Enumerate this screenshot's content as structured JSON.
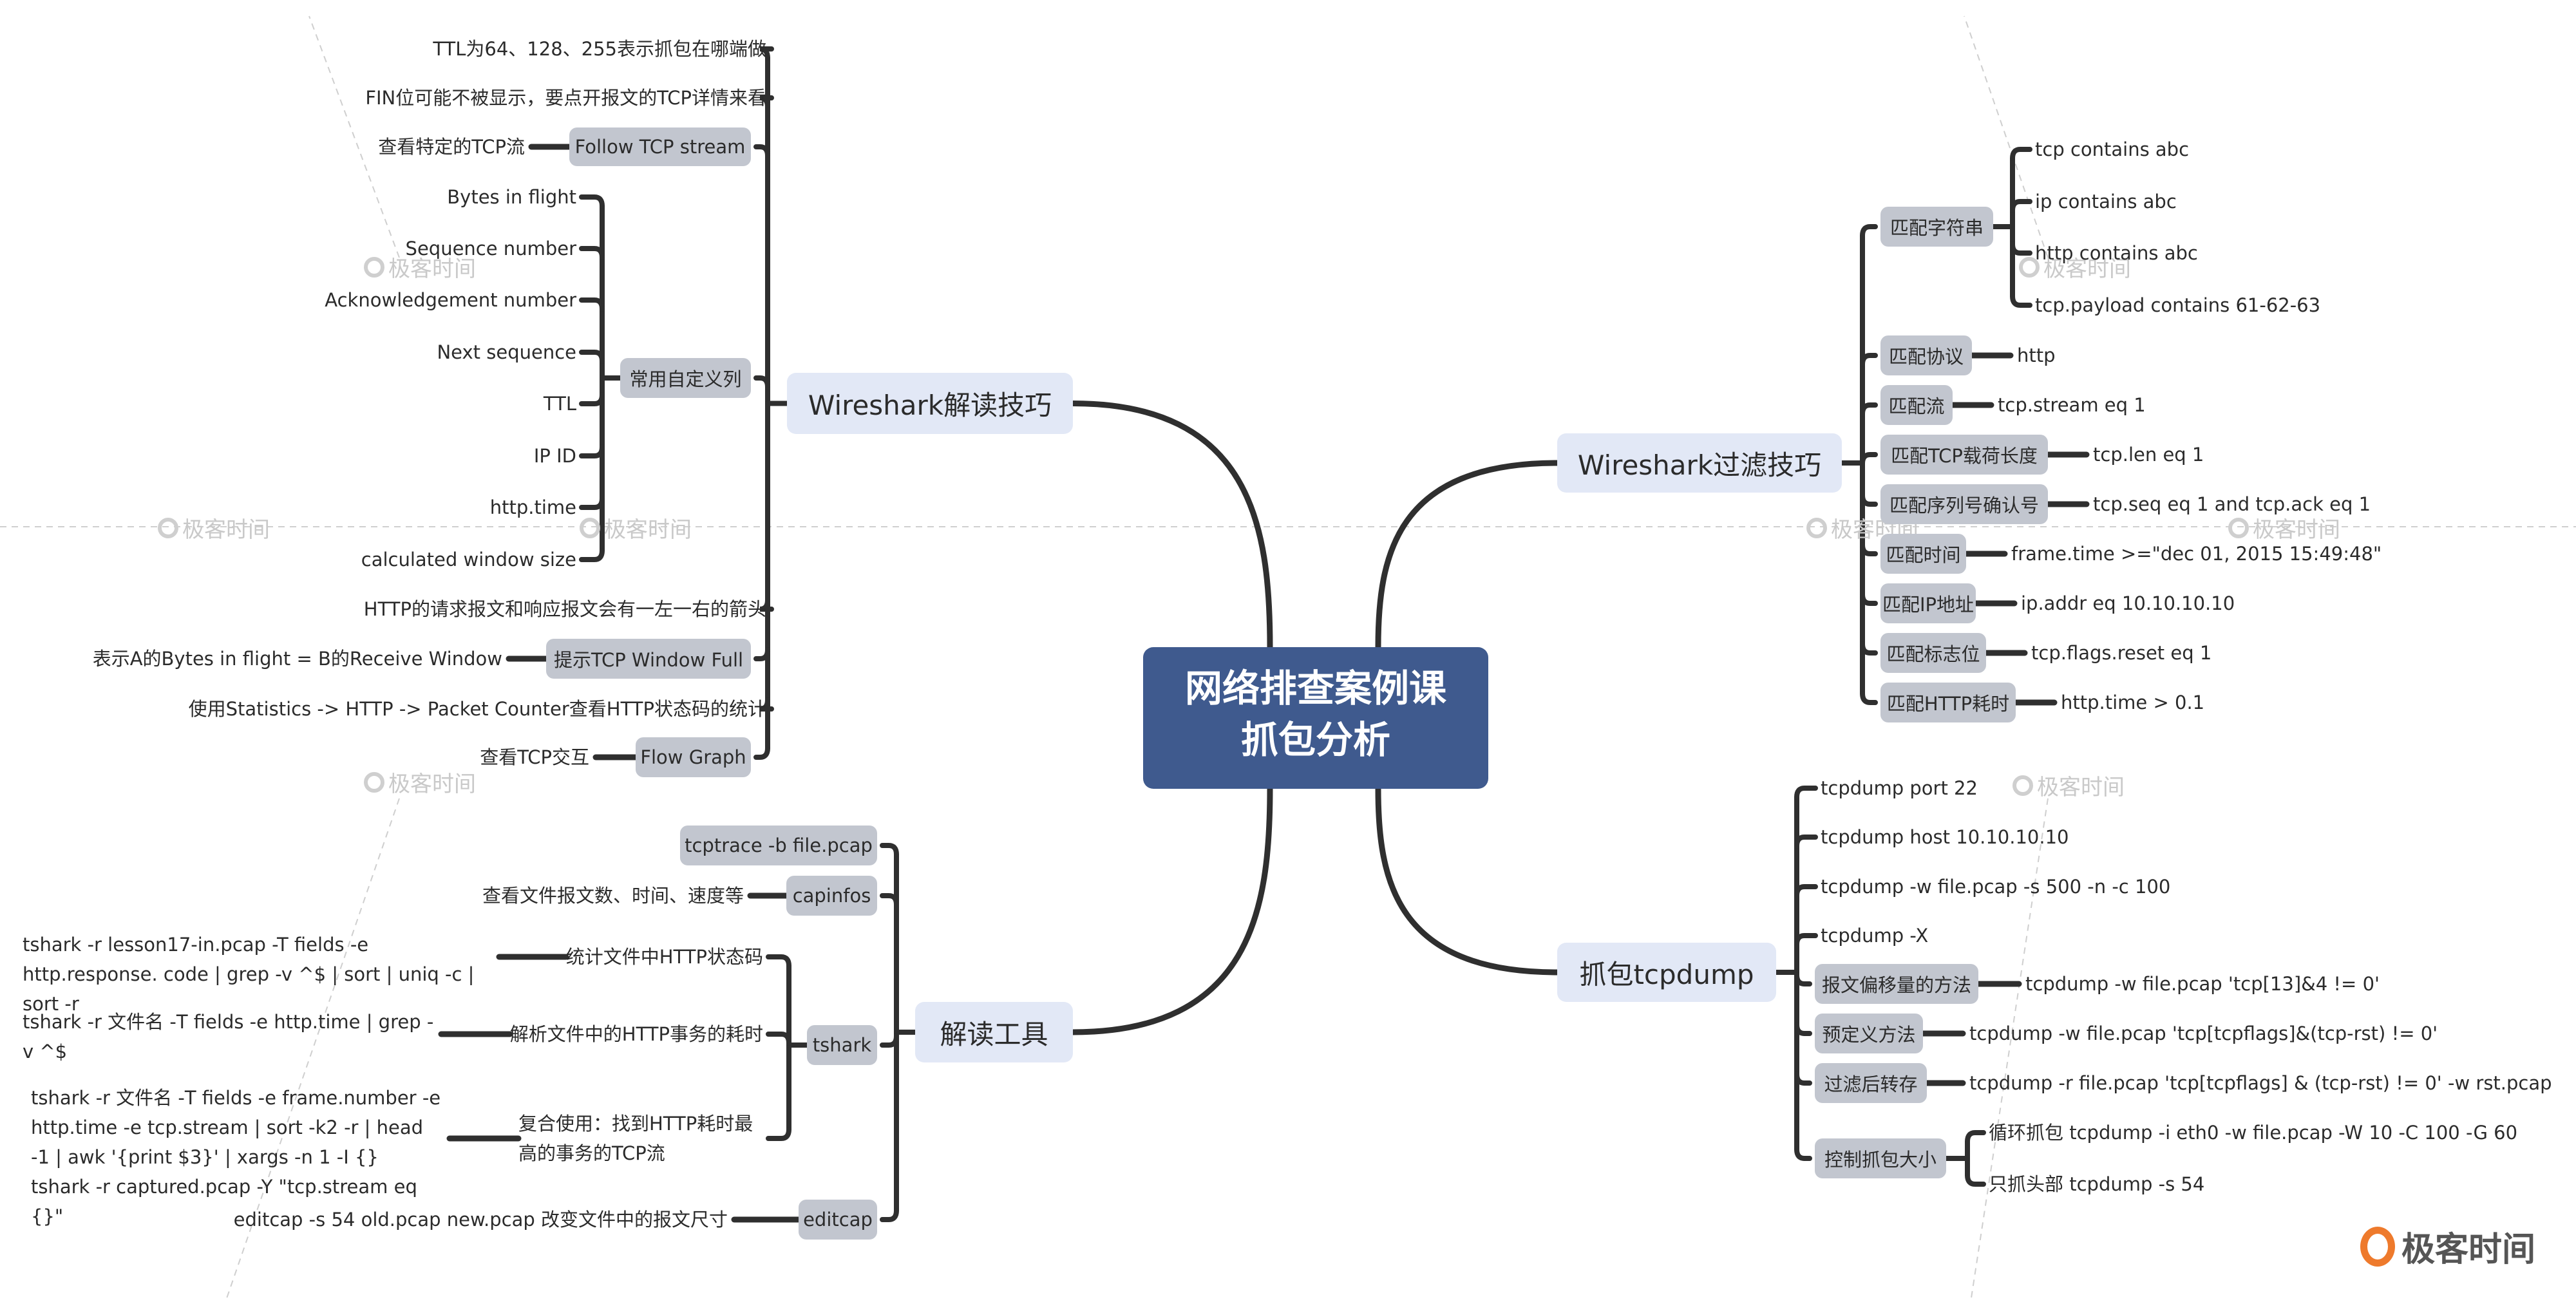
{
  "root": {
    "line1": "网络排查案例课",
    "line2": "抓包分析"
  },
  "watermark_text": "极客时间",
  "brand_text": "极客时间",
  "colors": {
    "root_bg": "#3f5a8e",
    "main_bg": "#e2e8f6",
    "sub_bg": "#c2c6cf",
    "line": "#2f2f2f",
    "brand": "#ee7a2c"
  },
  "wireshark_read": {
    "title": "Wireshark解读技巧",
    "ttl_note": "TTL为64、128、255表示抓包在哪端做",
    "fin_note": "FIN位可能不被显示，要点开报文的TCP详情来看",
    "follow": {
      "label": "Follow TCP stream",
      "desc": "查看特定的TCP流"
    },
    "columns": {
      "label": "常用自定义列",
      "items": [
        "Bytes in flight",
        "Sequence number",
        "Acknowledgement number",
        "Next sequence",
        "TTL",
        "IP ID",
        "http.time",
        "calculated window size"
      ]
    },
    "http_arrow_note": "HTTP的请求报文和响应报文会有一左一右的箭头",
    "window_full": {
      "label": "提示TCP Window Full",
      "desc": "表示A的Bytes in flight = B的Receive Window"
    },
    "stats_note": "使用Statistics -> HTTP -> Packet Counter查看HTTP状态码的统计",
    "flow_graph": {
      "label": "Flow Graph",
      "desc": "查看TCP交互"
    }
  },
  "tools": {
    "title": "解读工具",
    "tcptrace": "tcptrace -b file.pcap",
    "capinfos": {
      "label": "capinfos",
      "desc": "查看文件报文数、时间、速度等"
    },
    "tshark": {
      "label": "tshark",
      "items": [
        {
          "label": "统计文件中HTTP状态码",
          "cmd": "tshark -r lesson17-in.pcap -T fields -e http.response. code | grep -v ^$ | sort | uniq -c | sort -r"
        },
        {
          "label": "解析文件中的HTTP事务的耗时",
          "cmd": "tshark -r 文件名 -T fields -e http.time | grep -v ^$"
        },
        {
          "label": "复合使用：找到HTTP耗时最高的事务的TCP流",
          "cmd": "tshark -r 文件名 -T fields -e frame.number -e http.time -e tcp.stream | sort -k2 -r | head -1 | awk '{print $3}' | xargs -n 1 -I {} tshark -r captured.pcap -Y \"tcp.stream eq {}\""
        }
      ]
    },
    "editcap": {
      "label": "editcap",
      "desc": "editcap -s 54 old.pcap new.pcap 改变文件中的报文尺寸"
    }
  },
  "wireshark_filter": {
    "title": "Wireshark过滤技巧",
    "string_match": {
      "label": "匹配字符串",
      "items": [
        "tcp contains abc",
        "ip contains abc",
        "http contains abc",
        "tcp.payload contains 61-62-63"
      ]
    },
    "rows": [
      {
        "label": "匹配协议",
        "value": "http"
      },
      {
        "label": "匹配流",
        "value": "tcp.stream eq 1"
      },
      {
        "label": "匹配TCP载荷长度",
        "value": "tcp.len eq 1"
      },
      {
        "label": "匹配序列号确认号",
        "value": "tcp.seq eq 1 and tcp.ack eq 1"
      },
      {
        "label": "匹配时间",
        "value": "frame.time >=\"dec 01, 2015 15:49:48\""
      },
      {
        "label": "匹配IP地址",
        "value": "ip.addr eq 10.10.10.10"
      },
      {
        "label": "匹配标志位",
        "value": "tcp.flags.reset eq 1"
      },
      {
        "label": "匹配HTTP耗时",
        "value": "http.time > 0.1"
      }
    ]
  },
  "tcpdump": {
    "title": "抓包tcpdump",
    "plain": [
      "tcpdump port 22",
      "tcpdump host 10.10.10.10",
      "tcpdump -w file.pcap -s 500 -n -c 100",
      "tcpdump -X"
    ],
    "rows": [
      {
        "label": "报文偏移量的方法",
        "value": "tcpdump -w file.pcap 'tcp[13]&4 != 0'"
      },
      {
        "label": "预定义方法",
        "value": "tcpdump -w file.pcap 'tcp[tcpflags]&(tcp-rst) != 0'"
      },
      {
        "label": "过滤后转存",
        "value": "tcpdump -r file.pcap 'tcp[tcpflags] & (tcp-rst) != 0' -w rst.pcap"
      }
    ],
    "size_control": {
      "label": "控制抓包大小",
      "items": [
        "循环抓包 tcpdump -i eth0 -w file.pcap -W 10 -C 100 -G 60",
        "只抓头部 tcpdump -s 54"
      ]
    }
  }
}
